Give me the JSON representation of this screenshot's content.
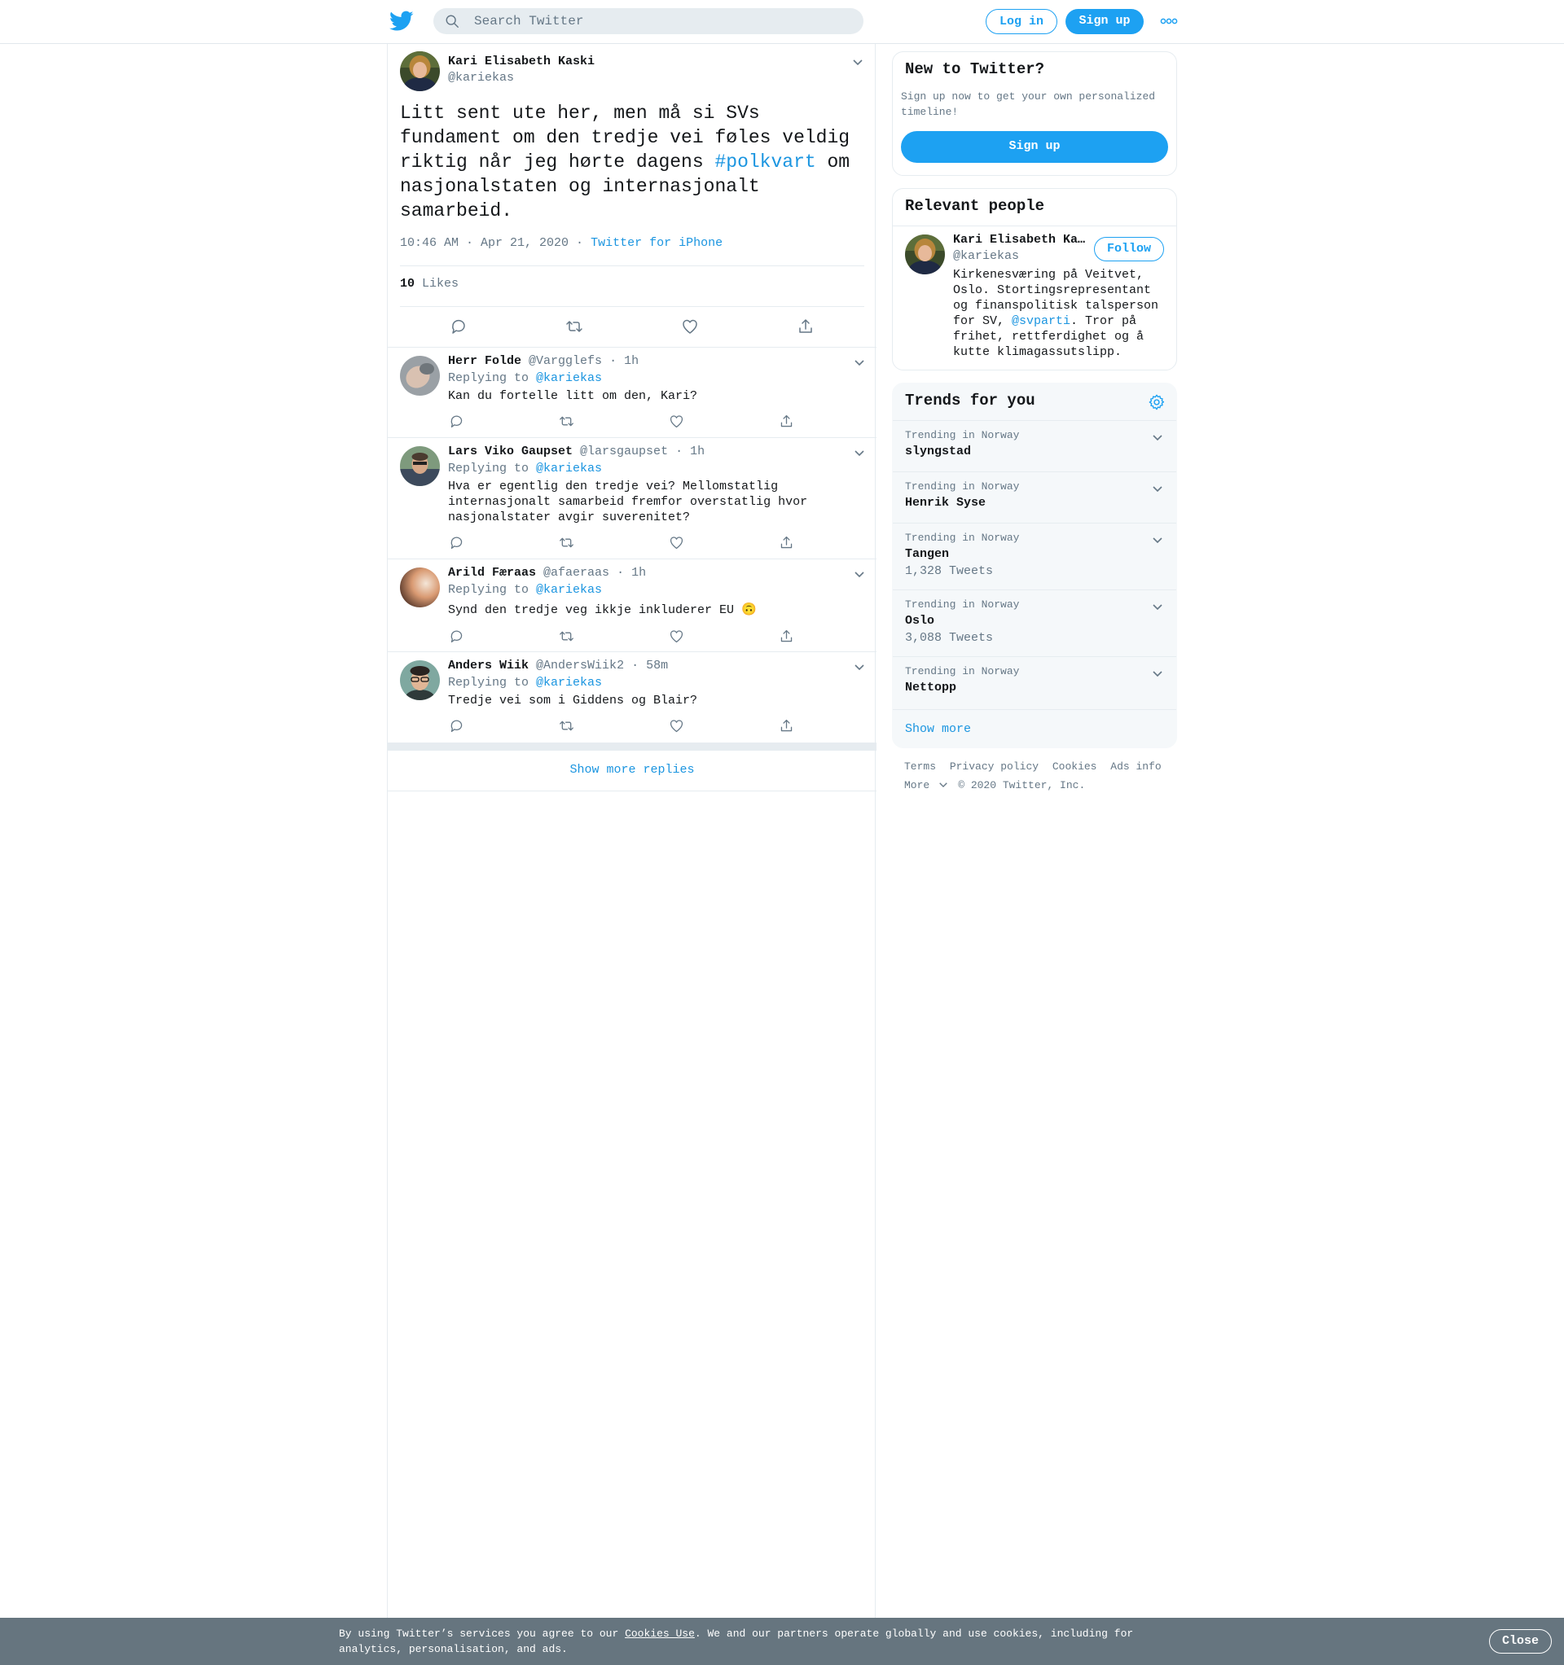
{
  "header": {
    "logo_icon": "twitter-bird-icon",
    "search_placeholder": "Search Twitter",
    "login_label": "Log in",
    "signup_label": "Sign up",
    "more_icon": "more-dots-icon"
  },
  "tweet": {
    "author_name": "Kari Elisabeth Kaski",
    "author_handle": "@kariekas",
    "text_before": "Litt sent ute her, men må si SVs fundament om den tredje vei føles veldig riktig når jeg hørte dagens ",
    "hashtag": "#polkvart",
    "text_after": " om nasjonalstaten og internasjonalt samarbeid.",
    "timestamp": "10:46 AM · Apr 21, 2020",
    "source_sep": " · ",
    "source": "Twitter for iPhone",
    "likes_count": "10",
    "likes_label": "Likes"
  },
  "replies": [
    {
      "name": "Herr Folde",
      "handle": "@Vargglefs",
      "time": "· 1h",
      "replying_label": "Replying to ",
      "replying_to": "@kariekas",
      "text": "Kan du fortelle litt om den, Kari?"
    },
    {
      "name": "Lars Viko Gaupset",
      "handle": "@larsgaupset",
      "time": "· 1h",
      "replying_label": "Replying to ",
      "replying_to": "@kariekas",
      "text": "Hva er egentlig den tredje vei? Mellomstatlig internasjonalt samarbeid fremfor overstatlig hvor nasjonalstater avgir suverenitet?"
    },
    {
      "name": "Arild Færaas",
      "handle": "@afaeraas",
      "time": "· 1h",
      "replying_label": "Replying to ",
      "replying_to": "@kariekas",
      "text": "Synd den tredje veg ikkje inkluderer EU 🙃"
    },
    {
      "name": "Anders Wiik",
      "handle": "@AndersWiik2",
      "time": "· 58m",
      "replying_label": "Replying to ",
      "replying_to": "@kariekas",
      "text": "Tredje vei som i Giddens og Blair?"
    }
  ],
  "show_more_replies": "Show more replies",
  "sidebar": {
    "new_title": "New to Twitter?",
    "new_desc": "Sign up now to get your own personalized timeline!",
    "new_signup": "Sign up",
    "relevant_title": "Relevant people",
    "person_name": "Kari Elisabeth Kaski",
    "person_handle": "@kariekas",
    "follow_label": "Follow",
    "bio_before": "Kirkenesværing på Veitvet, Oslo. Stortingsrepresentant og finanspolitisk talsperson for SV, ",
    "bio_mention": "@svparti",
    "bio_after": ". Tror på frihet, rettferdighet og å kutte klimagassutslipp.",
    "trends_title": "Trends for you",
    "trends": [
      {
        "context": "Trending in Norway",
        "name": "slyngstad",
        "count": ""
      },
      {
        "context": "Trending in Norway",
        "name": "Henrik Syse",
        "count": ""
      },
      {
        "context": "Trending in Norway",
        "name": "Tangen",
        "count": "1,328 Tweets"
      },
      {
        "context": "Trending in Norway",
        "name": "Oslo",
        "count": "3,088 Tweets"
      },
      {
        "context": "Trending in Norway",
        "name": "Nettopp",
        "count": ""
      }
    ],
    "trends_more": "Show more"
  },
  "footer": {
    "links": [
      "Terms",
      "Privacy policy",
      "Cookies",
      "Ads info"
    ],
    "more": "More",
    "copyright": "© 2020 Twitter, Inc."
  },
  "cookie": {
    "text_before": "By using Twitter’s services you agree to our ",
    "link": "Cookies Use",
    "text_after": ". We and our partners operate globally and use cookies, including for analytics, personalisation, and ads.",
    "close": "Close"
  },
  "colors": {
    "accent": "#1da1f2",
    "link": "#1b95e0",
    "muted": "#657786",
    "cookie_bar": "#66757f"
  }
}
